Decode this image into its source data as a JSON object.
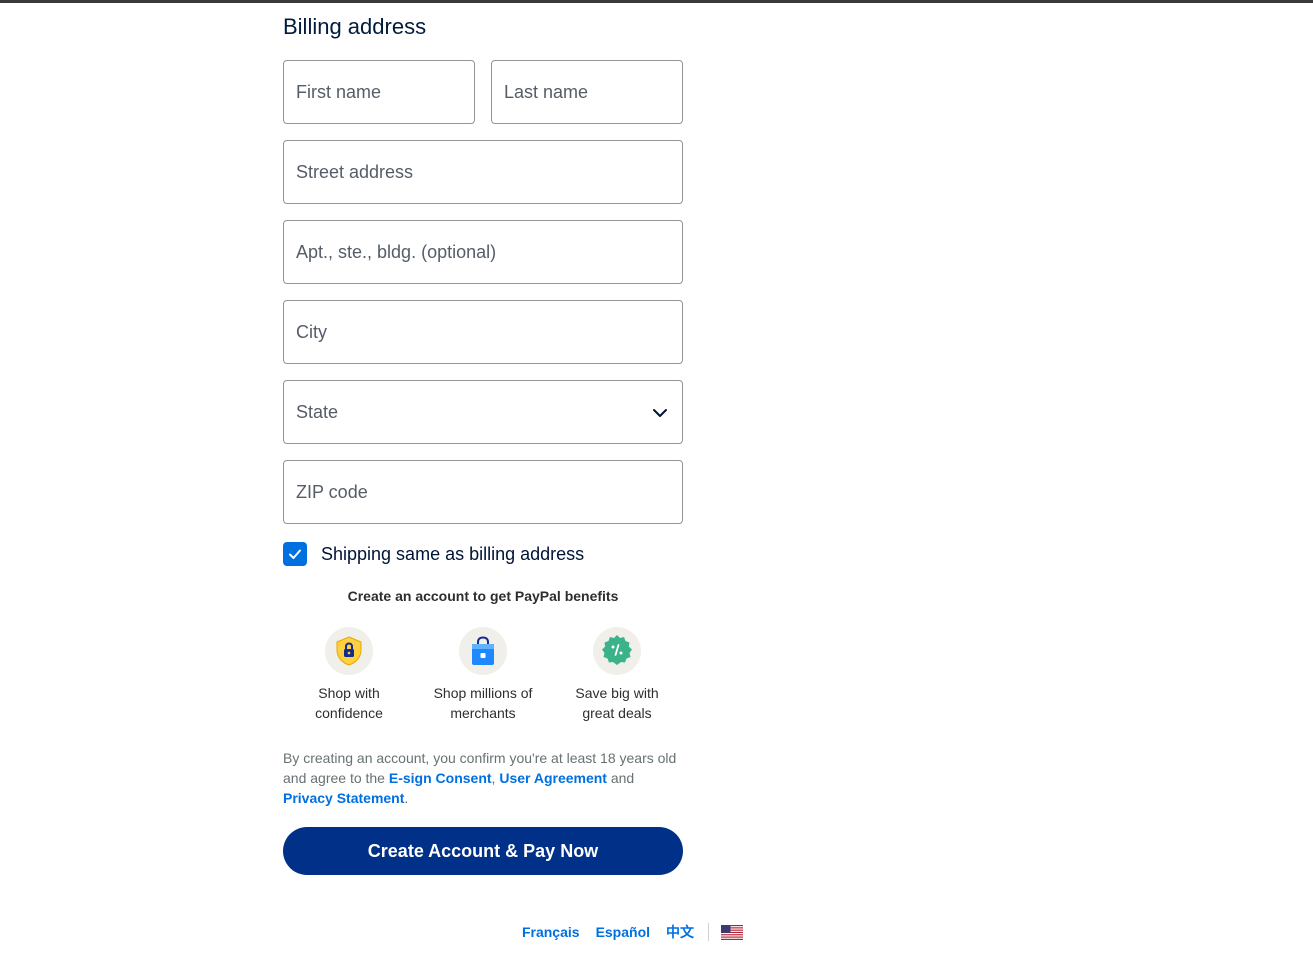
{
  "billing": {
    "heading": "Billing address",
    "first_name_placeholder": "First name",
    "last_name_placeholder": "Last name",
    "street_placeholder": "Street address",
    "apt_placeholder": "Apt., ste., bldg. (optional)",
    "city_placeholder": "City",
    "state_label": "State",
    "zip_placeholder": "ZIP code"
  },
  "shipping_same": {
    "label": "Shipping same as billing address",
    "checked": true
  },
  "benefits": {
    "title": "Create an account to get PayPal benefits",
    "items": [
      {
        "line1": "Shop with",
        "line2": "confidence",
        "icon": "shield-lock-icon"
      },
      {
        "line1": "Shop millions of",
        "line2": "merchants",
        "icon": "shopping-bag-icon"
      },
      {
        "line1": "Save big with",
        "line2": "great deals",
        "icon": "discount-badge-icon"
      }
    ]
  },
  "legal": {
    "text1": "By creating an account, you confirm you're at least 18 years old and agree to the",
    "esign": "E-sign Consent",
    "comma": ",",
    "user_agreement": "User Agreement",
    "and": "and",
    "privacy": "Privacy Statement",
    "period": "."
  },
  "cta": {
    "label": "Create Account & Pay Now"
  },
  "footer": {
    "languages": [
      "Français",
      "Español",
      "中文"
    ],
    "flag_icon": "us-flag-icon"
  },
  "colors": {
    "primary": "#003087",
    "link": "#0070e0",
    "checkbox": "#0070e0"
  }
}
